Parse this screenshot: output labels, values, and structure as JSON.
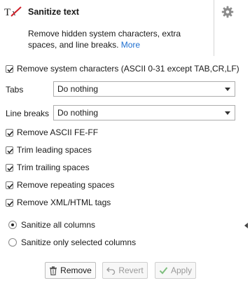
{
  "header": {
    "icon": "clear-format-icon",
    "title": "Sanitize text",
    "description": "Remove hidden system characters, extra spaces, and line breaks.",
    "more_link": "More",
    "settings_icon": "gear-icon"
  },
  "options": {
    "remove_system_chars": {
      "label": "Remove system characters (ASCII 0-31 except TAB,CR,LF)",
      "checked": true
    },
    "tabs": {
      "label": "Tabs",
      "value": "Do nothing"
    },
    "line_breaks": {
      "label": "Line breaks",
      "value": "Do nothing"
    },
    "checkboxes": [
      {
        "label": "Remove ASCII FE-FF",
        "checked": true
      },
      {
        "label": "Trim leading spaces",
        "checked": true
      },
      {
        "label": "Trim trailing spaces",
        "checked": true
      },
      {
        "label": "Remove repeating spaces",
        "checked": true
      },
      {
        "label": "Remove XML/HTML tags",
        "checked": true
      }
    ],
    "scope": [
      {
        "label": "Sanitize all columns",
        "selected": true
      },
      {
        "label": "Sanitize only selected columns",
        "selected": false
      }
    ]
  },
  "buttons": {
    "remove": "Remove",
    "revert": "Revert",
    "apply": "Apply"
  },
  "colors": {
    "link": "#1e6fd0",
    "check": "#1f1f1f",
    "apply_icon": "#7fbf7f"
  }
}
